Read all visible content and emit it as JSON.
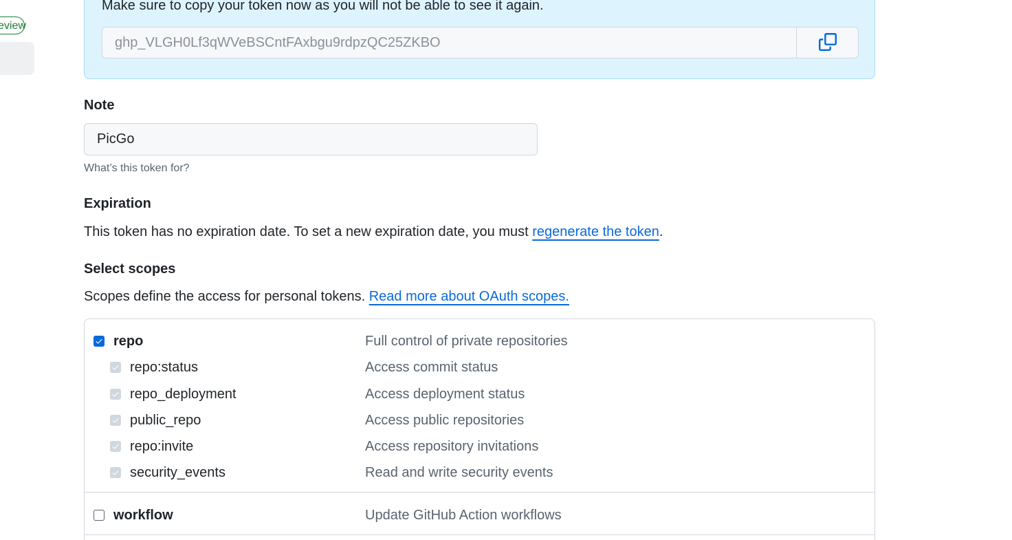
{
  "sidebar": {
    "preview_badge": "Preview"
  },
  "token_flash": {
    "message": "Make sure to copy your token now as you will not be able to see it again.",
    "token_value": "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",
    "copy_icon": "copy-icon"
  },
  "note": {
    "label": "Note",
    "value": "PicGo",
    "hint": "What’s this token for?"
  },
  "expiration": {
    "label": "Expiration",
    "text": "This token has no expiration date. To set a new expiration date, you must",
    "link": "regenerate the token",
    "suffix": "."
  },
  "scopes": {
    "label": "Select scopes",
    "text": "Scopes define the access for personal tokens.",
    "link": "Read more about OAuth scopes.",
    "items": [
      {
        "name": "repo",
        "desc": "Full control of private repositories",
        "checked": true
      },
      {
        "name": "repo:status",
        "desc": "Access commit status",
        "checked": true
      },
      {
        "name": "repo_deployment",
        "desc": "Access deployment status",
        "checked": true
      },
      {
        "name": "public_repo",
        "desc": "Access public repositories",
        "checked": true
      },
      {
        "name": "repo:invite",
        "desc": "Access repository invitations",
        "checked": true
      },
      {
        "name": "security_events",
        "desc": "Read and write security events",
        "checked": true
      },
      {
        "name": "workflow",
        "desc": "Update GitHub Action workflows",
        "checked": false
      }
    ]
  },
  "colors": {
    "accent": "#0969da",
    "flash_bg": "#ddf4ff",
    "success": "#1a7f37"
  }
}
